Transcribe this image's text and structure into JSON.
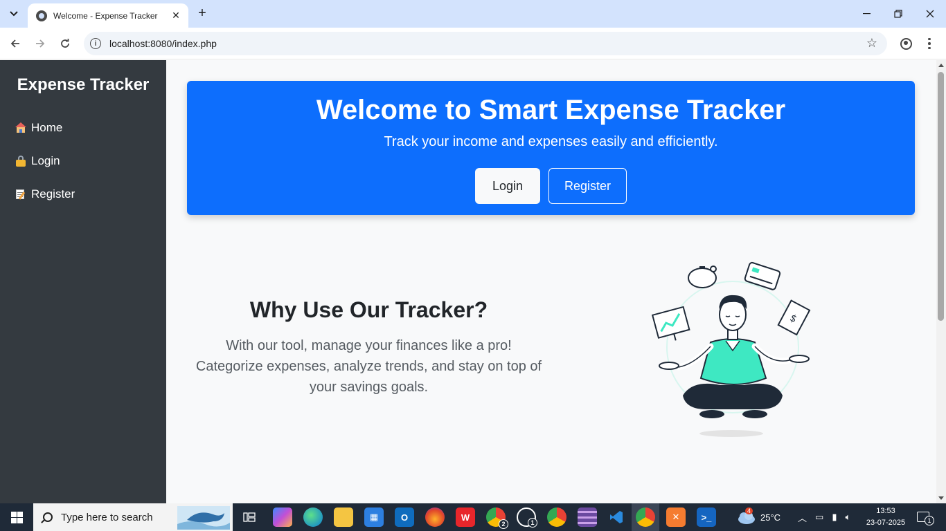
{
  "browser": {
    "tab_title": "Welcome - Expense Tracker",
    "url": "localhost:8080/index.php"
  },
  "sidebar": {
    "brand": "Expense Tracker",
    "items": [
      {
        "label": "Home",
        "icon": "home-icon"
      },
      {
        "label": "Login",
        "icon": "lock-icon"
      },
      {
        "label": "Register",
        "icon": "memo-icon"
      }
    ]
  },
  "hero": {
    "title": "Welcome to Smart Expense Tracker",
    "subtitle": "Track your income and expenses easily and efficiently.",
    "login_label": "Login",
    "register_label": "Register"
  },
  "why": {
    "title": "Why Use Our Tracker?",
    "text": "With our tool, manage your finances like a pro! Categorize expenses, analyze trends, and stay on top of your savings goals."
  },
  "taskbar": {
    "search_placeholder": "Type here to search",
    "weather_badge": "4",
    "temperature": "25°C",
    "time": "13:53",
    "date": "23-07-2025",
    "chrome_badge": "2",
    "whatsapp_badge": "1",
    "notification_badge": "1"
  },
  "colors": {
    "sidebar_bg": "#343a40",
    "hero_bg": "#0d6efd",
    "page_bg": "#f8f9fa",
    "illustration_accent": "#3ee8c2"
  }
}
